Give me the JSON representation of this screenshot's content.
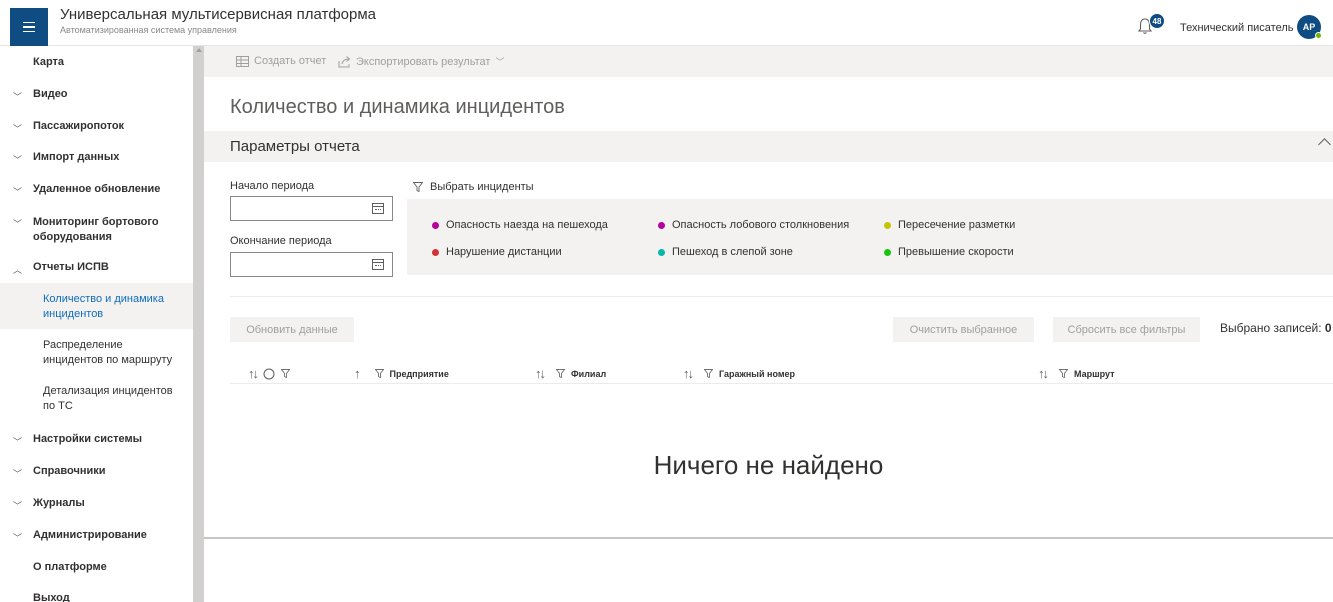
{
  "header": {
    "title": "Универсальная мультисервисная платформа",
    "subtitle": "Автоматизированная система управления",
    "notifications_count": "48",
    "user_name": "Технический писатель",
    "avatar_initials": "AP"
  },
  "sidebar": {
    "items": [
      {
        "label": "Карта"
      },
      {
        "label": "Видео"
      },
      {
        "label": "Пассажиропоток"
      },
      {
        "label": "Импорт данных"
      },
      {
        "label": "Удаленное обновление"
      },
      {
        "label": "Мониторинг бортового оборудования"
      },
      {
        "label": "Отчеты ИСПВ"
      },
      {
        "label": "Количество и динамика инцидентов"
      },
      {
        "label": "Распределение инцидентов по маршруту"
      },
      {
        "label": "Детализация инцидентов по ТС"
      },
      {
        "label": "Настройки системы"
      },
      {
        "label": "Справочники"
      },
      {
        "label": "Журналы"
      },
      {
        "label": "Администрирование"
      },
      {
        "label": "О платформе"
      },
      {
        "label": "Выход"
      }
    ]
  },
  "toolbar": {
    "create_report": "Создать отчет",
    "export_results": "Экспортировать результат"
  },
  "page": {
    "title": "Количество и динамика инцидентов"
  },
  "params": {
    "title": "Параметры отчета",
    "period_start_label": "Начало периода",
    "period_end_label": "Окончание периода",
    "period_start_value": "",
    "period_end_value": "",
    "incidents_label": "Выбрать инциденты",
    "incidents": [
      {
        "label": "Опасность наезда на пешехода",
        "color": "#b4009e"
      },
      {
        "label": "Опасность лобового столкновения",
        "color": "#b4009e"
      },
      {
        "label": "Пересечение разметки",
        "color": "#c4c400"
      },
      {
        "label": "Нарушение дистанции",
        "color": "#d13438"
      },
      {
        "label": "Пешеход в слепой зоне",
        "color": "#00b7a8"
      },
      {
        "label": "Превышение скорости",
        "color": "#16c60c"
      }
    ]
  },
  "actions": {
    "refresh": "Обновить данные",
    "clear_selected": "Очистить выбранное",
    "reset_filters": "Сбросить все фильтры",
    "selected_label": "Выбрано записей:",
    "selected_count": "0"
  },
  "table": {
    "columns": [
      "Предприятие",
      "Филиал",
      "Гаражный номер",
      "Маршрут"
    ],
    "empty_text": "Ничего не найдено"
  },
  "colors": {
    "brand": "#0f4c81",
    "active_link": "#0f6cbd"
  }
}
